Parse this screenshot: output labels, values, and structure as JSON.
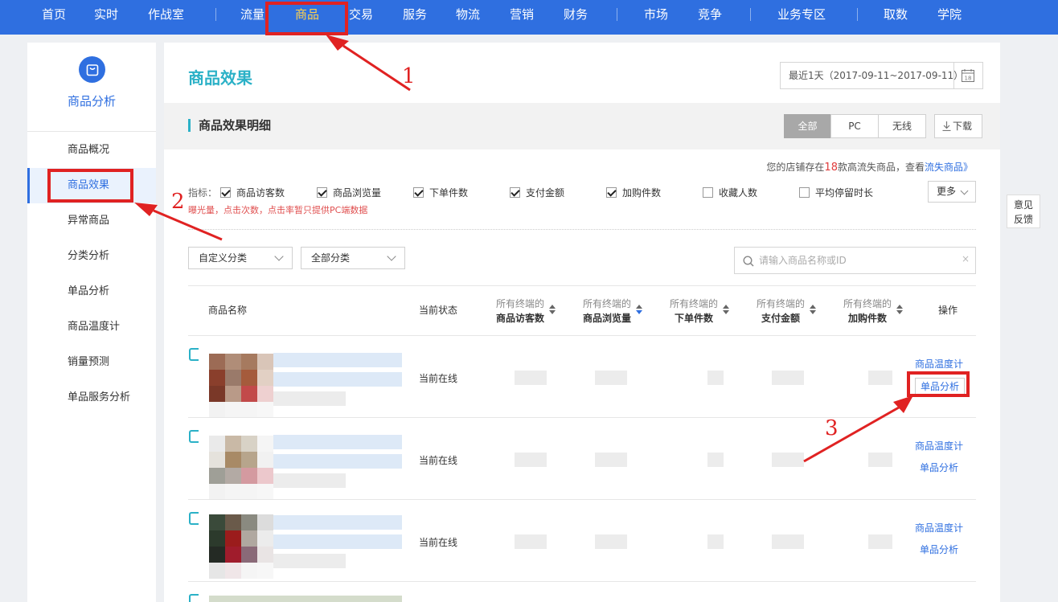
{
  "topnav": {
    "items": [
      "首页",
      "实时",
      "作战室",
      "流量",
      "商品",
      "交易",
      "服务",
      "物流",
      "营销",
      "财务",
      "市场",
      "竞争",
      "业务专区",
      "取数",
      "学院"
    ],
    "active": "商品"
  },
  "sidebar": {
    "title": "商品分析",
    "items": [
      "商品概况",
      "商品效果",
      "异常商品",
      "分类分析",
      "单品分析",
      "商品温度计",
      "销量预测",
      "单品服务分析"
    ],
    "active": "商品效果"
  },
  "main": {
    "title": "商品效果",
    "date_range": "最近1天（2017-09-11~2017-09-11）",
    "calendar_day": "18",
    "section_title": "商品效果明细",
    "tabs": [
      "全部",
      "PC",
      "无线"
    ],
    "active_tab": "全部",
    "download_label": "下载",
    "notice": {
      "prefix": "您的店铺存在",
      "count": "18",
      "middle": "款高流失商品，查看",
      "link": "流失商品》"
    },
    "indicators_label": "指标：",
    "indicators": [
      {
        "label": "商品访客数",
        "checked": true
      },
      {
        "label": "商品浏览量",
        "checked": true
      },
      {
        "label": "下单件数",
        "checked": true
      },
      {
        "label": "支付金额",
        "checked": true
      },
      {
        "label": "加购件数",
        "checked": true
      },
      {
        "label": "收藏人数",
        "checked": false
      },
      {
        "label": "平均停留时长",
        "checked": false
      }
    ],
    "more_label": "更多",
    "hint": "曝光量，点击次数，点击率暂只提供PC端数据",
    "filters": [
      "自定义分类",
      "全部分类"
    ],
    "search_placeholder": "请输入商品名称或ID",
    "search_clear": "×",
    "table": {
      "col_name": "商品名称",
      "col_status": "当前状态",
      "metric_cols": [
        {
          "line1": "所有终端的",
          "line2": "商品访客数"
        },
        {
          "line1": "所有终端的",
          "line2": "商品浏览量"
        },
        {
          "line1": "所有终端的",
          "line2": "下单件数"
        },
        {
          "line1": "所有终端的",
          "line2": "支付金额"
        },
        {
          "line1": "所有终端的",
          "line2": "加购件数"
        }
      ],
      "col_op": "操作",
      "rows": [
        {
          "status": "当前在线",
          "op1": "商品温度计",
          "op2": "单品分析"
        },
        {
          "status": "当前在线",
          "op1": "商品温度计",
          "op2": "单品分析"
        },
        {
          "status": "当前在线",
          "op1": "商品温度计",
          "op2": "单品分析"
        }
      ]
    }
  },
  "feedback": {
    "line1": "意见",
    "line2": "反馈"
  },
  "annotations": [
    "1",
    "2",
    "3"
  ],
  "colors": {
    "nav": "#2f6fe0",
    "accent": "#2bb1c7",
    "annotation": "#e02222",
    "link": "#2f6fe0"
  }
}
